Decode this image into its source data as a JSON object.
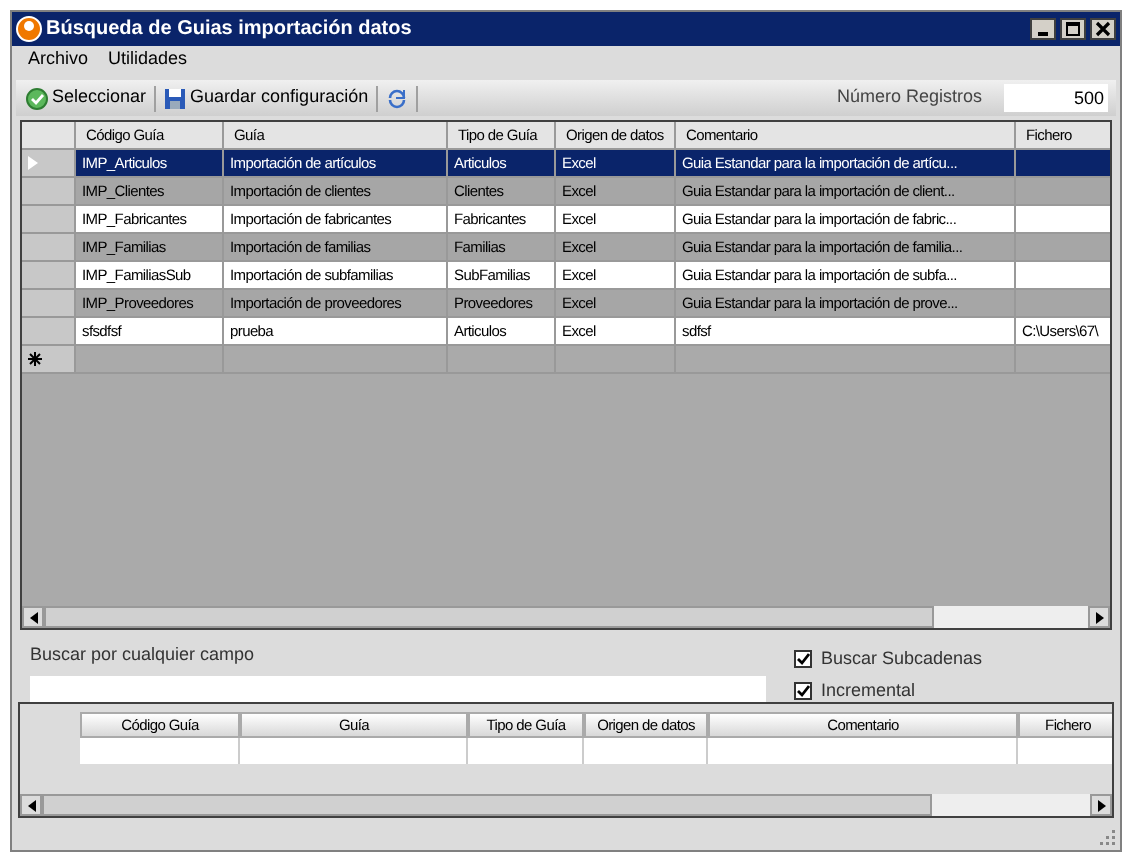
{
  "window": {
    "title": "Búsqueda de Guias importación datos"
  },
  "menu": [
    "Archivo",
    "Utilidades"
  ],
  "toolbar": {
    "buttons": [
      {
        "kind": "select",
        "label": "Seleccionar"
      },
      {
        "kind": "save",
        "label": "Guardar configuración"
      },
      {
        "kind": "refresh"
      }
    ],
    "count_label": "Número Registros",
    "count_value": "500"
  },
  "table": {
    "columns": [
      "Código Guía",
      "Guía",
      "Tipo de Guía",
      "Origen de datos",
      "Comentario",
      "Fichero"
    ],
    "rows": [
      {
        "selected": true,
        "cells": [
          "IMP_Articulos",
          "Importación de artículos",
          "Articulos",
          "Excel",
          "Guia Estandar para la importación de artícu...",
          ""
        ]
      },
      {
        "selected": false,
        "cells": [
          "IMP_Clientes",
          "Importación de clientes",
          "Clientes",
          "Excel",
          "Guia Estandar para la importación de client...",
          ""
        ]
      },
      {
        "selected": false,
        "cells": [
          "IMP_Fabricantes",
          "Importación de fabricantes",
          "Fabricantes",
          "Excel",
          "Guia Estandar para la importación de fabric...",
          ""
        ]
      },
      {
        "selected": false,
        "cells": [
          "IMP_Familias",
          "Importación de familias",
          "Familias",
          "Excel",
          "Guia Estandar para la importación de familia...",
          ""
        ]
      },
      {
        "selected": false,
        "cells": [
          "IMP_FamiliasSub",
          "Importación de subfamilias",
          "SubFamilias",
          "Excel",
          "Guia Estandar para la importación de subfa...",
          ""
        ]
      },
      {
        "selected": false,
        "cells": [
          "IMP_Proveedores",
          "Importación de proveedores",
          "Proveedores",
          "Excel",
          "Guia Estandar para la importación de prove...",
          ""
        ]
      },
      {
        "selected": false,
        "cells": [
          "sfsdfsf",
          "prueba",
          "Articulos",
          "Excel",
          "sdfsf",
          "C:\\Users\\67\\"
        ]
      }
    ]
  },
  "search": {
    "label": "Buscar por cualquier campo"
  },
  "options": [
    {
      "label": "Buscar Subcadenas",
      "checked": true
    },
    {
      "label": "Incremental",
      "checked": true
    }
  ],
  "filter_table": {
    "columns": [
      "Código Guía",
      "Guía",
      "Tipo de Guía",
      "Origen de datos",
      "Comentario",
      "Fichero"
    ]
  }
}
